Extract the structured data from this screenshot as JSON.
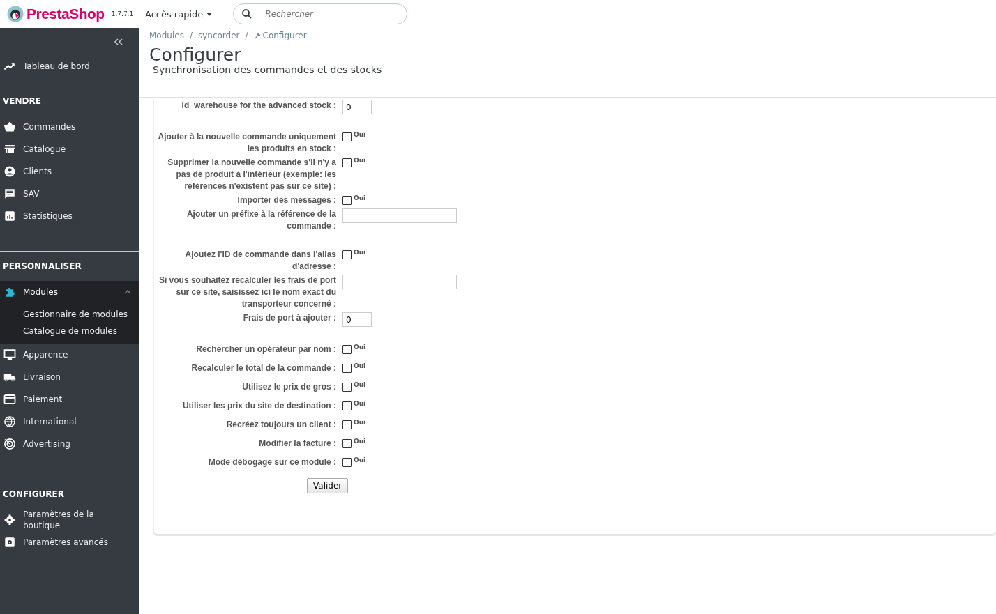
{
  "header": {
    "brand": "PrestaShop",
    "version": "1.7.7.1",
    "quick_access": "Accès rapide",
    "search": {
      "placeholder": "Rechercher"
    }
  },
  "sidebar": {
    "dashboard": "Tableau de bord",
    "sections": [
      {
        "title": "VENDRE",
        "items": [
          {
            "label": "Commandes",
            "selected": false
          },
          {
            "label": "Catalogue",
            "selected": false
          },
          {
            "label": "Clients",
            "selected": false
          },
          {
            "label": "SAV",
            "selected": false
          },
          {
            "label": "Statistiques",
            "selected": false
          }
        ]
      },
      {
        "title": "PERSONNALISER",
        "items": [
          {
            "label": "Modules",
            "selected": true,
            "expanded": true,
            "children": [
              {
                "label": "Gestionnaire de modules"
              },
              {
                "label": "Catalogue de modules"
              }
            ]
          },
          {
            "label": "Apparence",
            "selected": false
          },
          {
            "label": "Livraison",
            "selected": false
          },
          {
            "label": "Paiement",
            "selected": false
          },
          {
            "label": "International",
            "selected": false
          },
          {
            "label": "Advertising",
            "selected": false
          }
        ]
      },
      {
        "title": "CONFIGURER",
        "items": [
          {
            "label": "Paramètres de la boutique",
            "selected": false
          },
          {
            "label": "Paramètres avancés",
            "selected": false
          }
        ]
      }
    ]
  },
  "breadcrumb": {
    "separator": "/",
    "items": [
      "Modules",
      "syncorder",
      "Configurer"
    ]
  },
  "page": {
    "title": "Configurer",
    "subtitle": "Synchronisation des commandes et des stocks"
  },
  "form": {
    "fields": [
      {
        "kind": "small",
        "label": "Id_warehouse for the advanced stock :",
        "value": "0"
      },
      {
        "kind": "checkbox",
        "label": "Ajouter à la nouvelle commande uniquement les produits en stock :",
        "checked": false,
        "option": "Oui"
      },
      {
        "kind": "checkbox",
        "label": "Supprimer la nouvelle commande s'il n'y a pas de produit à l'intérieur (exemple: les références n'existent pas sur ce site) :",
        "checked": false,
        "option": "Oui"
      },
      {
        "kind": "checkbox",
        "label": "Importer des messages :",
        "checked": false,
        "option": "Oui"
      },
      {
        "kind": "wide",
        "label": "Ajouter un préfixe à la référence de la commande :"
      },
      {
        "kind": "checkbox",
        "label": "Ajoutez l'ID de commande dans l'alias d'adresse :",
        "checked": false,
        "option": "Oui"
      },
      {
        "kind": "wide",
        "label": "Si vous souhaitez recalculer les frais de port sur ce site, saisissez ici le nom exact du transporteur concerné :"
      },
      {
        "kind": "small",
        "label": "Frais de port à ajouter :",
        "value": "0"
      },
      {
        "kind": "checkbox",
        "label": "Rechercher un opérateur par nom :",
        "checked": false,
        "option": "Oui"
      },
      {
        "kind": "checkbox",
        "label": "Recalculer le total de la commande :",
        "checked": false,
        "option": "Oui"
      },
      {
        "kind": "checkbox",
        "label": "Utilisez le prix de gros :",
        "checked": false,
        "option": "Oui"
      },
      {
        "kind": "checkbox",
        "label": "Utiliser les prix du site de destination :",
        "checked": false,
        "option": "Oui"
      },
      {
        "kind": "checkbox",
        "label": "Recréez toujours un client :",
        "checked": false,
        "option": "Oui"
      },
      {
        "kind": "checkbox",
        "label": "Modifier la facture :",
        "checked": false,
        "option": "Oui"
      },
      {
        "kind": "checkbox",
        "label": "Mode débogage sur ce module :",
        "checked": false,
        "option": "Oui"
      }
    ],
    "submit": "Valider"
  }
}
